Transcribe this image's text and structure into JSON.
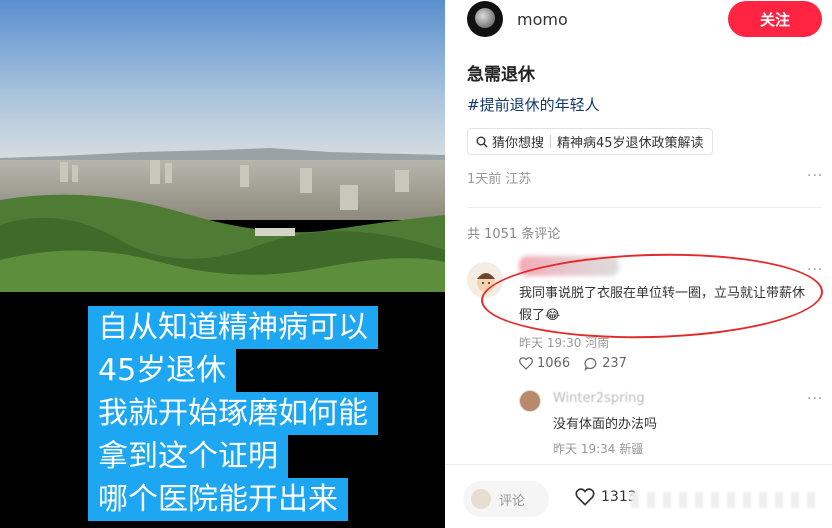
{
  "photo": {
    "caption_lines": [
      "自从知道精神病可以",
      "45岁退休",
      "我就开始琢磨如何能",
      "拿到这个证明",
      "哪个医院能开出来"
    ]
  },
  "author": {
    "name": "momo",
    "follow_label": "关注"
  },
  "note": {
    "title": "急需退休",
    "hashtag": "#提前退休的年轻人",
    "search_prefix": "猜你想搜",
    "search_suggestion": "精神病45岁退休政策解读",
    "meta": "1天前 江苏",
    "more": "···"
  },
  "comments": {
    "count_label": "共 1051 条评论",
    "top": {
      "text": "我同事说脱了衣服在单位转一圈，立马就让带薪休假了😂",
      "meta": "昨天 19:30 河南",
      "likes": "1066",
      "replies": "237",
      "more": "···"
    },
    "reply": {
      "user": "Winter2spring",
      "text": "没有体面的办法吗",
      "meta": "昨天 19:34 新疆",
      "more": "···"
    }
  },
  "bottom": {
    "comment_placeholder": "评论",
    "likes": "1313"
  },
  "colors": {
    "accent": "#ff2442",
    "caption_bg": "#1da6f2",
    "hashtag": "#13386c",
    "annotation": "#e32a2a"
  }
}
